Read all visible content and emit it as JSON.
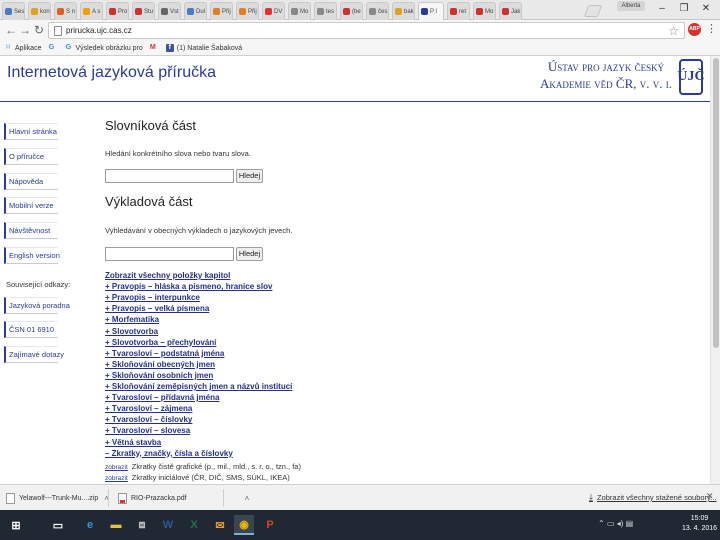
{
  "browser": {
    "tabs": [
      {
        "label": "Ses",
        "color": "#4a7ac9"
      },
      {
        "label": "kon",
        "color": "#e0a020"
      },
      {
        "label": "S n",
        "color": "#e06020"
      },
      {
        "label": "A s",
        "color": "#f0a000"
      },
      {
        "label": "Pro",
        "color": "#d03030"
      },
      {
        "label": "Stu",
        "color": "#d03030"
      },
      {
        "label": "Vst",
        "color": "#666666"
      },
      {
        "label": "Dul",
        "color": "#4a7ac9"
      },
      {
        "label": "Přij",
        "color": "#e08020"
      },
      {
        "label": "Přij",
        "color": "#e08020"
      },
      {
        "label": "DV",
        "color": "#e03030"
      },
      {
        "label": "Mo",
        "color": "#888888"
      },
      {
        "label": "tes",
        "color": "#888888"
      },
      {
        "label": "(be",
        "color": "#d03030"
      },
      {
        "label": "čes",
        "color": "#888888"
      },
      {
        "label": "bak",
        "color": "#e0a020"
      },
      {
        "label": "P l",
        "color": "#2a3b9f",
        "active": true
      },
      {
        "label": "ret",
        "color": "#d03030"
      },
      {
        "label": "Mo",
        "color": "#d03030"
      },
      {
        "label": "Jak",
        "color": "#d03030"
      }
    ],
    "profile": "Alberta",
    "url": "prirucka.ujc.cas.cz",
    "abp_label": "ABP",
    "bookmarks": [
      {
        "label": "Aplikace",
        "icon": "apps-grid-icon"
      },
      {
        "label": "G",
        "icon": "google-icon"
      },
      {
        "label": "Výsledek obrázku pro",
        "icon": "google-icon"
      },
      {
        "label": "M",
        "icon": "gmail-icon"
      },
      {
        "label": "(1) Natalie Šabaková",
        "icon": "facebook-icon"
      }
    ]
  },
  "page": {
    "site_title": "Internetová jazyková příručka",
    "org_line1": "Ústav pro jazyk český",
    "org_line2": "Akademie věd ČR, v. v. i.",
    "logo_letters": "ÚJČ",
    "nav": [
      "Hlavní stránka",
      "O příručce",
      "Nápověda",
      "Mobilní verze",
      "Návštěvnost",
      "English version"
    ],
    "related_label": "Související odkazy:",
    "related": [
      "Jazyková poradna",
      "ČSN 01 6910",
      "Zajímavé dotazy"
    ],
    "dict_heading": "Slovníková část",
    "dict_desc": "Hledání konkrétního slova nebo tvaru slova.",
    "search_button": "Hledej",
    "expl_heading": "Výkladová část",
    "expl_desc": "Vyhledávání v obecných výkladech o jazykových jevech.",
    "chapter_links": [
      "Zobrazit všechny položky kapitol",
      "+ Pravopis – hláska a písmeno, hranice slov",
      "+ Pravopis – interpunkce",
      "+ Pravopis – velká písmena",
      "+ Morfematika",
      "+ Slovotvorba",
      "+ Slovotvorba – přechylování",
      "+ Tvarosloví – podstatná jména",
      "+ Skloňování obecných jmen",
      "+ Skloňování osobních jmen",
      "+ Skloňování zeměpisných jmen a názvů institucí",
      "+ Tvarosloví – přídavná jména",
      "+ Tvarosloví – zájmena",
      "+ Tvarosloví – číslovky",
      "+ Tvarosloví – slovesa",
      "+ Větná stavba",
      "– Zkratky, značky, čísla a číslovky"
    ],
    "abbr_rows": [
      {
        "link": "zobrazit",
        "text": "Zkratky čistě grafické (p., mil., mld., s. r. o., tzn., fa)"
      },
      {
        "link": "zobrazit",
        "text": "Zkratky iniciálové (ČR, DIČ, SMS, SÚKL, IKEA)"
      }
    ]
  },
  "downloads": {
    "items": [
      {
        "label": "Yelawolf---Trunk-Mu....zip",
        "icon": "file-icon"
      },
      {
        "label": "RIO-Prazacka.pdf",
        "icon": "pdf-file-icon"
      }
    ],
    "show_all": "Zobrazit všechny stažené soubory..."
  },
  "taskbar": {
    "time": "15:09",
    "date": "13. 4. 2016"
  }
}
